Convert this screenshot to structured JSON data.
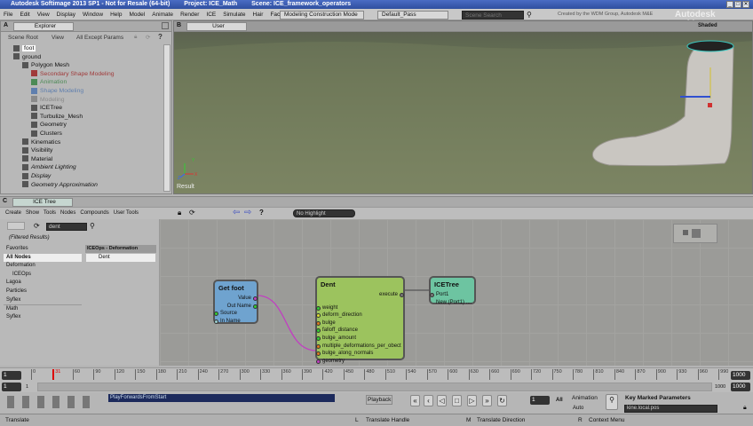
{
  "titlebar": {
    "app": "Autodesk Softimage 2013 SP1 - Not for Resale (64-bit)",
    "project": "Project: ICE_Math",
    "scene": "Scene: ICE_framework_operators",
    "buttons": [
      "_",
      "□",
      "✕"
    ]
  },
  "menubar": {
    "items": [
      "File",
      "Edit",
      "View",
      "Display",
      "Window",
      "Help",
      "Model",
      "Animate",
      "Render",
      "ICE",
      "Simulate",
      "Hair",
      "Face Robot"
    ],
    "construction_mode": "Modeling Construction Mode",
    "pass": "Default_Pass",
    "search_placeholder": "Scene Search",
    "credit": "Created by the WDM Group, Autodesk M&E",
    "brand": "Autodesk Softimage"
  },
  "explorer": {
    "view_letter": "A",
    "title": "Explorer",
    "toolbar": [
      "Scene Root",
      "View",
      "All Except Params"
    ],
    "help": "?",
    "tree": [
      {
        "label": "foot",
        "depth": 0,
        "selected": true,
        "color": "#111"
      },
      {
        "label": "ground",
        "depth": 0,
        "color": "#111"
      },
      {
        "label": "Polygon Mesh",
        "depth": 1,
        "color": "#111"
      },
      {
        "label": "Secondary Shape Modeling",
        "depth": 2,
        "color": "#a03a3a"
      },
      {
        "label": "Animation",
        "depth": 2,
        "color": "#4c8a55"
      },
      {
        "label": "Shape Modeling",
        "depth": 2,
        "color": "#5f7fae"
      },
      {
        "label": "Modeling",
        "depth": 2,
        "color": "#8a8a8a"
      },
      {
        "label": "ICETree",
        "depth": 2,
        "color": "#111"
      },
      {
        "label": "Turbulize_Mesh",
        "depth": 2,
        "color": "#111"
      },
      {
        "label": "Geometry",
        "depth": 2,
        "color": "#111"
      },
      {
        "label": "Clusters",
        "depth": 2,
        "color": "#111"
      },
      {
        "label": "Kinematics",
        "depth": 1,
        "color": "#111"
      },
      {
        "label": "Visibility",
        "depth": 1,
        "color": "#111"
      },
      {
        "label": "Material",
        "depth": 1,
        "color": "#111"
      },
      {
        "label": "Ambient Lighting",
        "depth": 1,
        "color": "#111",
        "italic": true
      },
      {
        "label": "Display",
        "depth": 1,
        "color": "#111",
        "italic": true
      },
      {
        "label": "Geometry Approximation",
        "depth": 1,
        "color": "#111",
        "italic": true
      }
    ]
  },
  "viewport": {
    "view_letter": "B",
    "camera": "User",
    "shading": "Shaded",
    "label": "Result",
    "axes": [
      "X",
      "Y",
      "Z"
    ]
  },
  "ice": {
    "view_letter": "C",
    "title": "ICE Tree",
    "menu": [
      "Create",
      "Show",
      "Tools",
      "Nodes",
      "Compounds",
      "User Tools"
    ],
    "highlight": "No Highlight",
    "search_value": "dent",
    "filtered": "(Filtered Results)",
    "categories": [
      {
        "label": "Favorites"
      },
      {
        "label": "All Nodes",
        "selected": true
      },
      {
        "label": "Deformation"
      },
      {
        "label": "ICEOps",
        "indent": true
      },
      {
        "label": "Lagoa"
      },
      {
        "label": "Particles"
      },
      {
        "label": "Syflex"
      },
      {
        "label": "Math"
      },
      {
        "label": "Syflex"
      }
    ],
    "results_header": "ICEOps - Deformation",
    "results": [
      "Dent"
    ],
    "nodes": {
      "getfoot": {
        "title": "Get foot",
        "outputs": [
          "Value",
          "Out Name"
        ],
        "inputs": [
          "Source",
          "In Name"
        ],
        "color": "#6fa3cf"
      },
      "dent": {
        "title": "Dent",
        "output": "execute",
        "inputs": [
          "weight",
          "deform_direction",
          "bulge",
          "falloff_distance",
          "bulge_amount",
          "multiple_deformations_per_obect",
          "bulge_along_normals",
          "geometry"
        ],
        "color": "#9cc35e"
      },
      "icetree": {
        "title": "ICETree",
        "inputs": [
          "Port1",
          "New (Port1) ...."
        ],
        "color": "#6dc4a1"
      }
    }
  },
  "timeline": {
    "start": "1",
    "end": "1000",
    "current_frame": "31",
    "range_start": "1",
    "range_end_label": "1000",
    "range_end": "1000",
    "range_mark": "1",
    "ticks": [
      "0",
      "31",
      "60",
      "90",
      "120",
      "150",
      "180",
      "210",
      "240",
      "270",
      "300",
      "330",
      "360",
      "390",
      "420",
      "450",
      "480",
      "510",
      "540",
      "570",
      "600",
      "630",
      "660",
      "690",
      "720",
      "750",
      "780",
      "810",
      "840",
      "870",
      "900",
      "930",
      "960",
      "990"
    ]
  },
  "playback": {
    "command": "PlayForwardsFromStart",
    "playback_label": "Playback",
    "frame": "1",
    "all": "All",
    "animation": "Animation",
    "auto": "Auto",
    "key_marked": "Key Marked Parameters",
    "param": "kine.local.pos"
  },
  "status": {
    "left": "Translate",
    "hint1": "Translate Handle",
    "hint2": "Translate Direction",
    "hint3": "Context Menu",
    "key1": "L",
    "key2": "M",
    "key3": "R"
  }
}
